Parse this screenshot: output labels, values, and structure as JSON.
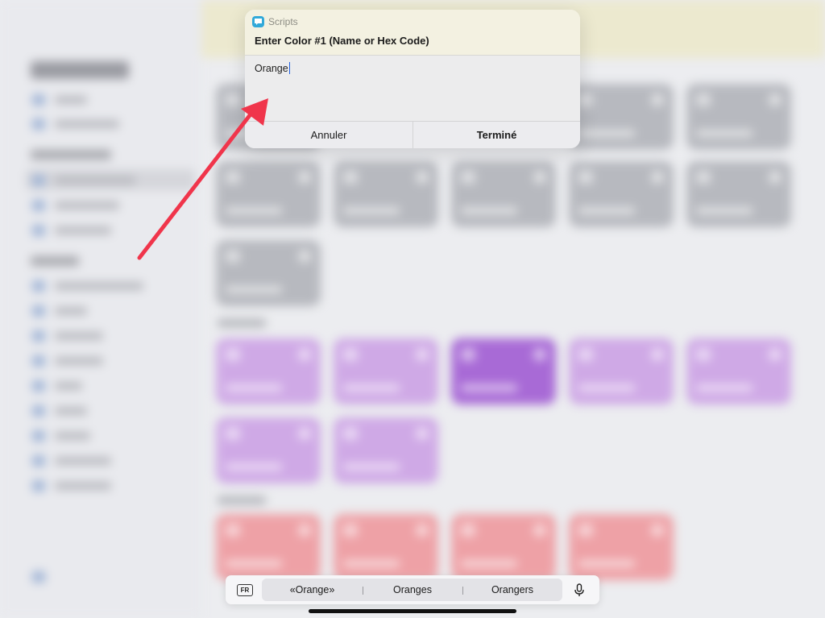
{
  "alert": {
    "app_name": "Scripts",
    "app_icon": "message-bubble-icon",
    "prompt": "Enter Color #1 (Name or Hex Code)",
    "input_value": "Orange",
    "cancel_label": "Annuler",
    "done_label": "Terminé"
  },
  "keyboard": {
    "language": "FR",
    "suggestions": [
      "«Orange»",
      "Oranges",
      "Orangers"
    ],
    "mic_icon": "microphone-icon"
  },
  "annotation": {
    "arrow_color": "#f0354b"
  },
  "colors": {
    "tile_gray": "#b7b9bf",
    "tile_purple": "#cfa9e6",
    "tile_purple_selected": "#a86ad6",
    "tile_red": "#eea1a6"
  }
}
